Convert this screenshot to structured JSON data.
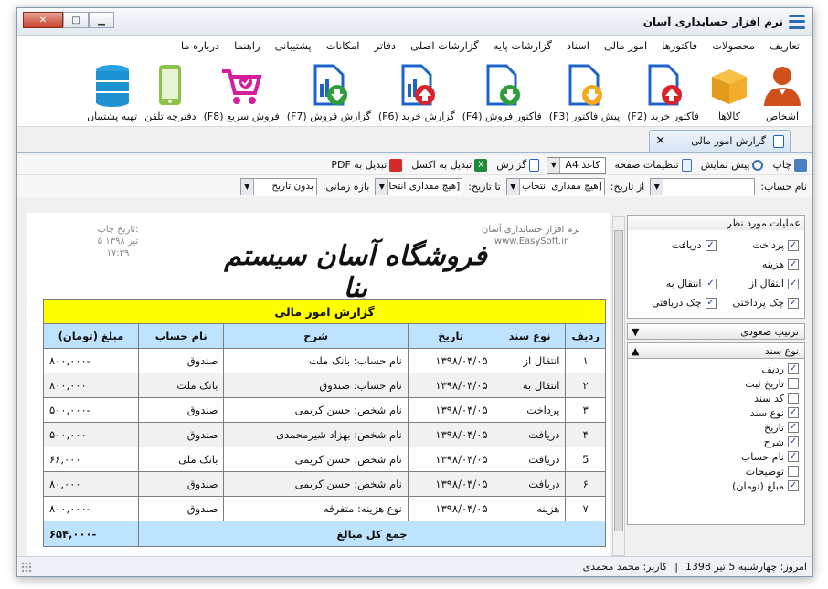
{
  "window": {
    "title": "نرم افزار حسابداری آسان"
  },
  "menu": [
    "تعاریف",
    "محصولات",
    "فاکتورها",
    "امور مالی",
    "اسناد",
    "گزارشات پایه",
    "گزارشات اصلی",
    "دفاتر",
    "امکانات",
    "پشتیبانی",
    "راهنما",
    "درباره ما"
  ],
  "ribbon": [
    {
      "label": "اشخاص",
      "icon": "person-icon"
    },
    {
      "label": "کالاها",
      "icon": "box-icon"
    },
    {
      "label": "فاکتور خرید (F2)",
      "icon": "doc-up-icon"
    },
    {
      "label": "پیش فاکتور (F3)",
      "icon": "doc-down-orange-icon"
    },
    {
      "label": "فاکتور فروش (F4)",
      "icon": "doc-down-green-icon"
    },
    {
      "label": "گزارش خرید (F6)",
      "icon": "chart-doc-up-icon"
    },
    {
      "label": "گزارش فروش (F7)",
      "icon": "chart-doc-down-icon"
    },
    {
      "label": "فروش سریع (F8)",
      "icon": "cart-icon"
    },
    {
      "label": "دفترچه تلفن",
      "icon": "phone-icon"
    },
    {
      "label": "تهیه پشتیبان",
      "icon": "database-icon"
    }
  ],
  "tab": {
    "label": "گزارش امور مالی",
    "close": "✕"
  },
  "toolbar": {
    "print": "چاپ",
    "preview": "پیش نمایش",
    "page_settings": "تنظیمات صفحه",
    "paper": "کاغذ A4",
    "report": "گزارش",
    "to_excel": "تبدیل به اکسل",
    "to_pdf": "تبدیل به PDF"
  },
  "filters": {
    "account_label": "نام حساب:",
    "account_value": "",
    "from_label": "از تاریخ:",
    "from_value": "[هیچ مقداری انتخاب",
    "to_label": "تا تاریخ:",
    "to_value": "[هیچ مقداری انتخاب",
    "range_label": "بازه زمانی:",
    "range_value": "بدون تاریخ"
  },
  "ops": {
    "title": "عملیات مورد نظر",
    "items": [
      {
        "label": "پرداخت",
        "checked": true
      },
      {
        "label": "دریافت",
        "checked": true
      },
      {
        "label": "هزینه",
        "checked": true
      },
      {
        "label": "",
        "checked": false
      },
      {
        "label": "انتقال از",
        "checked": true
      },
      {
        "label": "انتقال به",
        "checked": true
      },
      {
        "label": "چک پرداختی",
        "checked": true
      },
      {
        "label": "چک دریافتی",
        "checked": true
      }
    ]
  },
  "sort_header": "ترتیب صعودی",
  "columns_panel": {
    "title": "نوع سند",
    "items": [
      {
        "label": "ردیف",
        "checked": true
      },
      {
        "label": "تاریخ ثبت",
        "checked": false
      },
      {
        "label": "کد سند",
        "checked": false
      },
      {
        "label": "نوع سند",
        "checked": true
      },
      {
        "label": "تاریخ",
        "checked": true
      },
      {
        "label": "شرح",
        "checked": true
      },
      {
        "label": "نام حساب",
        "checked": true
      },
      {
        "label": "توضیحات",
        "checked": false
      },
      {
        "label": "مبلغ (تومان)",
        "checked": true
      }
    ]
  },
  "report": {
    "print_date_label": "تاریخ چاپ:",
    "print_date": "۵ تیر ۱۳۹۸",
    "print_time": "۱۷:۳۹",
    "brand_line1": "نرم افزار حسابداری آسان",
    "brand_line2": "www.EasySoft.ir",
    "shop_name": "فروشگاه آسان سیستم بنا",
    "title": "گزارش امور مالی",
    "headers": [
      "ردیف",
      "نوع سند",
      "تاریخ",
      "شرح",
      "نام حساب",
      "مبلغ (تومان)"
    ],
    "rows": [
      [
        "۱",
        "انتقال از",
        "۱۳۹۸/۰۴/۰۵",
        "نام حساب: بانک ملت",
        "صندوق",
        "-۸۰۰,۰۰۰"
      ],
      [
        "۲",
        "انتقال به",
        "۱۳۹۸/۰۴/۰۵",
        "نام حساب: صندوق",
        "بانک ملت",
        "۸۰۰,۰۰۰"
      ],
      [
        "۳",
        "پرداخت",
        "۱۳۹۸/۰۴/۰۵",
        "نام شخص: حسن کریمی",
        "صندوق",
        "-۵۰۰,۰۰۰"
      ],
      [
        "۴",
        "دریافت",
        "۱۳۹۸/۰۴/۰۵",
        "نام شخص: بهزاد شیرمحمدی",
        "صندوق",
        "۵۰۰,۰۰۰"
      ],
      [
        "5",
        "دریافت",
        "۱۳۹۸/۰۴/۰۵",
        "نام شخص: حسن کریمی",
        "بانک ملی",
        "۶۶,۰۰۰"
      ],
      [
        "۶",
        "دریافت",
        "۱۳۹۸/۰۴/۰۵",
        "نام شخص: حسن کریمی",
        "صندوق",
        "۸۰,۰۰۰"
      ],
      [
        "۷",
        "هزینه",
        "۱۳۹۸/۰۴/۰۵",
        "نوع هزینه: متفرقه",
        "صندوق",
        "-۸۰۰,۰۰۰"
      ]
    ],
    "total_label": "جمع کل مبالغ",
    "total_value": "-۶۵۴,۰۰۰"
  },
  "status": {
    "today": "امروز: چهارشنبه 5 تیر 1398",
    "sep": "|",
    "user": "کاربر: محمد محمدی"
  },
  "colors": {
    "accent": "#2b6cb0",
    "header_bg": "#bde3ff",
    "title_bg": "#ffff00"
  }
}
